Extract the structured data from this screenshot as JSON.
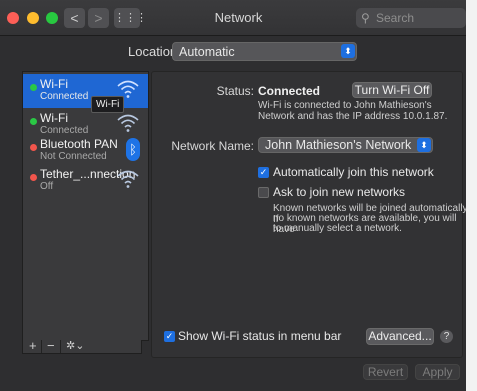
{
  "window": {
    "title": "Network"
  },
  "titlebar": {
    "search_placeholder": "Search",
    "back_glyph": "<",
    "forward_glyph": ">",
    "grid_glyph": "⋮⋮⋮"
  },
  "location": {
    "label": "Location:",
    "value": "Automatic"
  },
  "services": [
    {
      "name": "Wi-Fi",
      "status": "Connected",
      "state": "green",
      "icon": "wifi-icon",
      "selected": true
    },
    {
      "name": "Wi-Fi",
      "status": "Connected",
      "state": "green",
      "icon": "wifi-icon",
      "selected": false
    },
    {
      "name": "Bluetooth PAN",
      "status": "Not Connected",
      "state": "red",
      "icon": "bluetooth-icon",
      "selected": false
    },
    {
      "name": "Tether_...nnection",
      "status": "Off",
      "state": "red",
      "icon": "wifi-icon",
      "selected": false
    }
  ],
  "tooltip": "Wi-Fi",
  "sidebar_toolbar": {
    "add": "+",
    "remove": "−",
    "action": "✲⌄"
  },
  "detail": {
    "status_label": "Status:",
    "status_value": "Connected",
    "turn_off_button": "Turn Wi-Fi Off",
    "status_desc_1": "Wi-Fi is connected to John Mathieson's",
    "status_desc_2": "Network and has the IP address 10.0.1.87.",
    "network_name_label": "Network Name:",
    "network_name_value": "John Mathieson's Network",
    "auto_join_label": "Automatically join this network",
    "auto_join_checked": true,
    "ask_join_label": "Ask to join new networks",
    "ask_join_checked": false,
    "ask_desc_1": "Known networks will be joined automatically. If",
    "ask_desc_2": "no known networks are available, you will have",
    "ask_desc_3": "to manually select a network.",
    "show_menu_label": "Show Wi-Fi status in menu bar",
    "show_menu_checked": true,
    "advanced_button": "Advanced...",
    "help_glyph": "?"
  },
  "footer": {
    "revert": "Revert",
    "apply": "Apply"
  },
  "colors": {
    "accent": "#1e6fe0",
    "connected": "#2ac845",
    "disconnected": "#f1554c"
  }
}
